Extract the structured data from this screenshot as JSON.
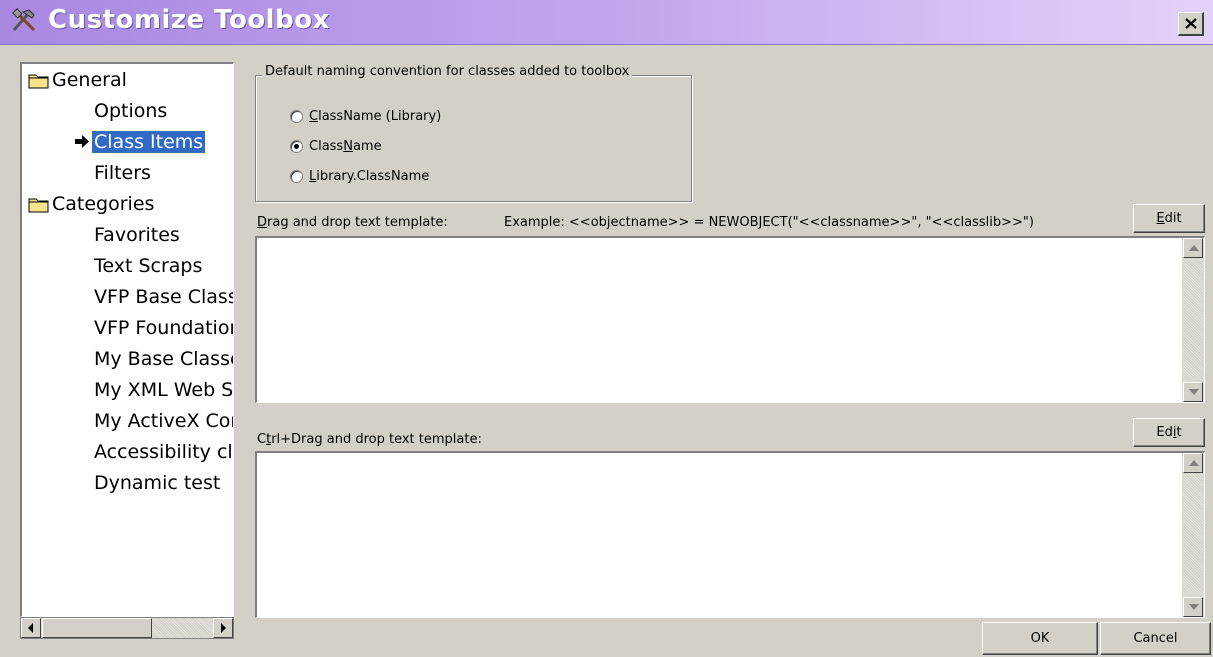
{
  "window": {
    "title": "Customize Toolbox",
    "title_icon": "tools-icon",
    "close_icon": "close-icon"
  },
  "tree": {
    "items": [
      {
        "label": "General",
        "type": "folder"
      },
      {
        "label": "Options",
        "type": "child"
      },
      {
        "label": "Class Items",
        "type": "child",
        "selected": true
      },
      {
        "label": "Filters",
        "type": "child"
      },
      {
        "label": "Categories",
        "type": "folder"
      },
      {
        "label": "Favorites",
        "type": "child"
      },
      {
        "label": "Text Scraps",
        "type": "child"
      },
      {
        "label": "VFP Base Classe",
        "type": "child"
      },
      {
        "label": "VFP Foundation",
        "type": "child"
      },
      {
        "label": "My Base Classes",
        "type": "child"
      },
      {
        "label": "My XML Web Se",
        "type": "child"
      },
      {
        "label": "My ActiveX Con",
        "type": "child"
      },
      {
        "label": "Accessibility clas",
        "type": "child"
      },
      {
        "label": "Dynamic test",
        "type": "child"
      }
    ]
  },
  "naming": {
    "legend": "Default naming convention for classes added to toolbox",
    "options": [
      {
        "hotkey": "C",
        "rest": "lassName (Library)",
        "selected": false
      },
      {
        "prefix": "Class",
        "hotkey": "N",
        "rest": "ame",
        "selected": true
      },
      {
        "hotkey": "L",
        "rest": "ibrary.ClassName",
        "selected": false
      }
    ]
  },
  "drag_template": {
    "label_hotkey": "D",
    "label_rest": "rag and drop text template:",
    "example": "Example: <<objectname>> = NEWOBJECT(\"<<classname>>\", \"<<classlib>>\")",
    "edit_hotkey": "E",
    "edit_rest": "dit",
    "value": ""
  },
  "ctrl_drag_template": {
    "label_prefix": "C",
    "label_hotkey": "t",
    "label_rest": "rl+Drag and drop text template:",
    "edit_prefix": "Ed",
    "edit_hotkey": "i",
    "edit_rest": "t",
    "value": ""
  },
  "buttons": {
    "ok": "OK",
    "cancel": "Cancel"
  },
  "colors": {
    "title_gradient_start": "#a988e2",
    "title_gradient_end": "#e3d3fa",
    "selection": "#316ac5",
    "dialog_bg": "#d4d0c8"
  }
}
